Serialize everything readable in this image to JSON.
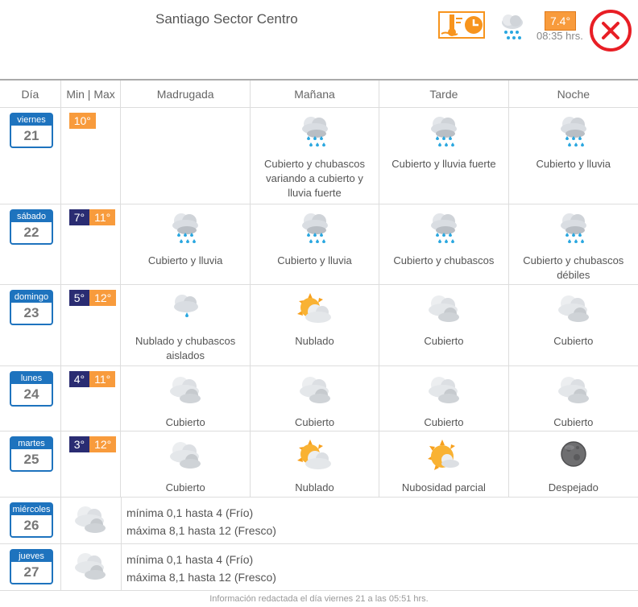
{
  "header": {
    "station": "Santiago Sector Centro",
    "current_temp": "7.4°",
    "current_time": "08:35 hrs."
  },
  "columns": {
    "day": "Día",
    "minmax": "Min | Max",
    "madrugada": "Madrugada",
    "manana": "Mañana",
    "tarde": "Tarde",
    "noche": "Noche"
  },
  "days": [
    {
      "name": "viernes",
      "num": "21",
      "max": "10°",
      "p": [
        {
          "icon": "none",
          "text": ""
        },
        {
          "icon": "rain-heavy",
          "text": "Cubierto y chubascos variando a cubierto y lluvia fuerte"
        },
        {
          "icon": "rain-heavy",
          "text": "Cubierto y lluvia fuerte"
        },
        {
          "icon": "rain-heavy",
          "text": "Cubierto y lluvia"
        }
      ]
    },
    {
      "name": "sábado",
      "num": "22",
      "min": "7°",
      "max": "11°",
      "p": [
        {
          "icon": "rain-heavy",
          "text": "Cubierto y lluvia"
        },
        {
          "icon": "rain-heavy",
          "text": "Cubierto y lluvia"
        },
        {
          "icon": "rain-heavy",
          "text": "Cubierto y chubascos"
        },
        {
          "icon": "rain-heavy",
          "text": "Cubierto y chubascos débiles"
        }
      ]
    },
    {
      "name": "domingo",
      "num": "23",
      "min": "5°",
      "max": "12°",
      "p": [
        {
          "icon": "rain-light",
          "text": "Nublado y chubascos aislados"
        },
        {
          "icon": "sun-cloud",
          "text": "Nublado"
        },
        {
          "icon": "cloud",
          "text": "Cubierto"
        },
        {
          "icon": "cloud",
          "text": "Cubierto"
        }
      ]
    },
    {
      "name": "lunes",
      "num": "24",
      "min": "4°",
      "max": "11°",
      "p": [
        {
          "icon": "cloud",
          "text": "Cubierto"
        },
        {
          "icon": "cloud",
          "text": "Cubierto"
        },
        {
          "icon": "cloud",
          "text": "Cubierto"
        },
        {
          "icon": "cloud",
          "text": "Cubierto"
        }
      ]
    },
    {
      "name": "martes",
      "num": "25",
      "min": "3°",
      "max": "12°",
      "p": [
        {
          "icon": "cloud",
          "text": "Cubierto"
        },
        {
          "icon": "sun-cloud",
          "text": "Nublado"
        },
        {
          "icon": "sun-partial",
          "text": "Nubosidad parcial"
        },
        {
          "icon": "moon",
          "text": "Despejado"
        }
      ]
    }
  ],
  "extended": [
    {
      "name": "miércoles",
      "num": "26",
      "line1": "mínima 0,1 hasta 4 (Frío)",
      "line2": "máxima 8,1 hasta 12 (Fresco)"
    },
    {
      "name": "jueves",
      "num": "27",
      "line1": "mínima 0,1 hasta 4 (Frío)",
      "line2": "máxima 8,1 hasta 12 (Fresco)"
    }
  ],
  "footer": "Información redactada el día viernes 21 a las 05:51 hrs."
}
